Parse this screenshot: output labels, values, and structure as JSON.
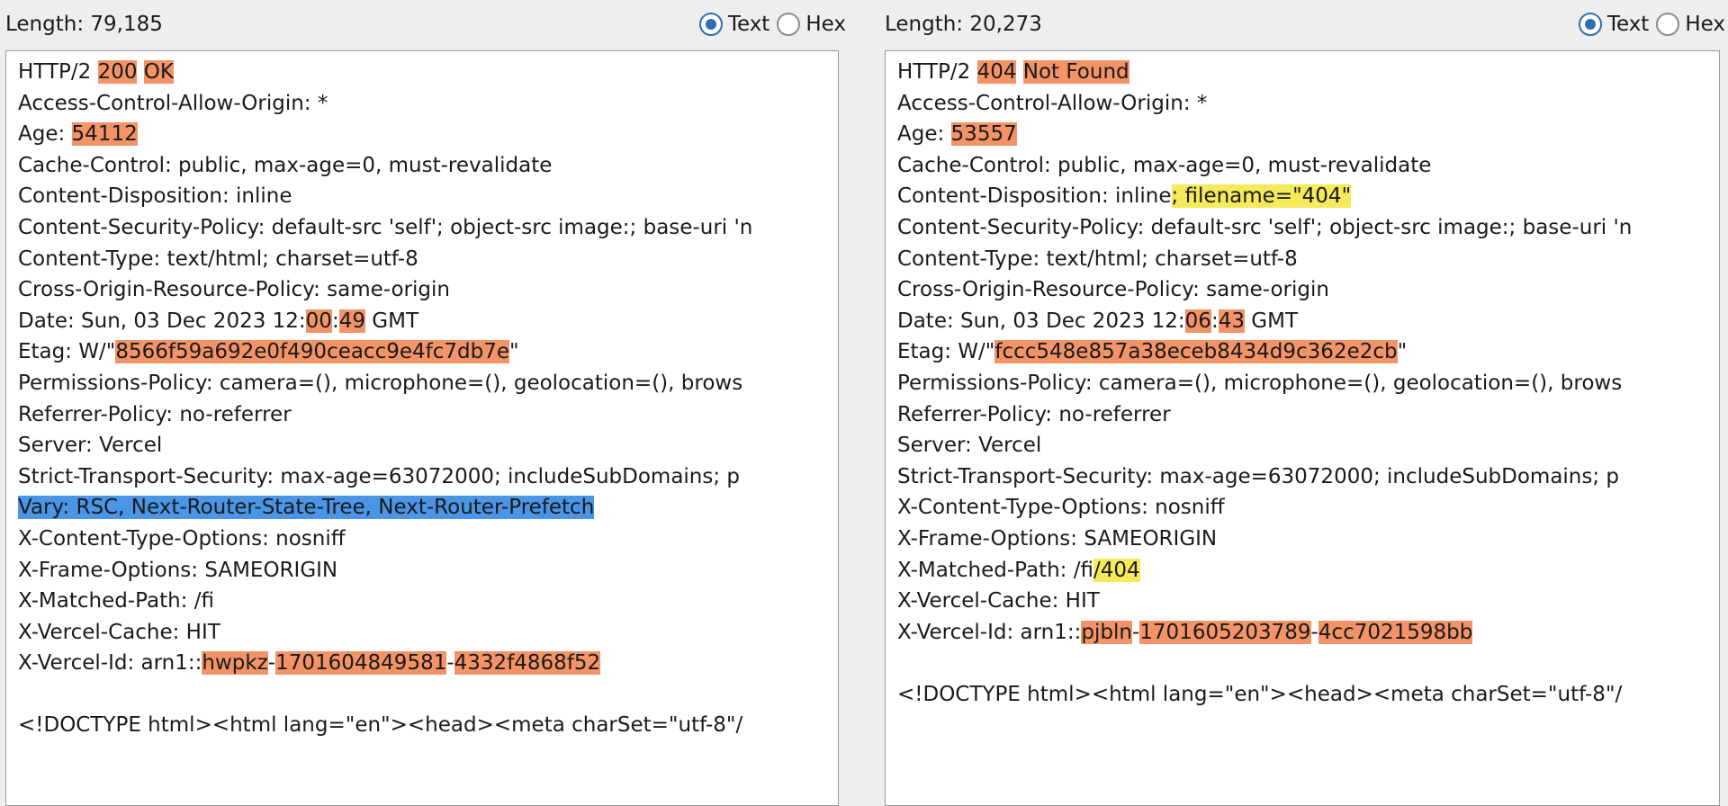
{
  "left": {
    "length_label": "Length: 79,185",
    "view_options": [
      {
        "label": "Text",
        "checked": true
      },
      {
        "label": "Hex",
        "checked": false
      }
    ],
    "lines": [
      [
        {
          "t": "HTTP/2 "
        },
        {
          "t": "200",
          "h": "o"
        },
        {
          "t": " "
        },
        {
          "t": "OK",
          "h": "o"
        }
      ],
      [
        {
          "t": "Access-Control-Allow-Origin: *"
        }
      ],
      [
        {
          "t": "Age: "
        },
        {
          "t": "54112",
          "h": "o"
        }
      ],
      [
        {
          "t": "Cache-Control: public, max-age=0, must-revalidate"
        }
      ],
      [
        {
          "t": "Content-Disposition: inline"
        }
      ],
      [
        {
          "t": "Content-Security-Policy: default-src 'self'; object-src image:; base-uri 'n"
        }
      ],
      [
        {
          "t": "Content-Type: text/html; charset=utf-8"
        }
      ],
      [
        {
          "t": "Cross-Origin-Resource-Policy: same-origin"
        }
      ],
      [
        {
          "t": "Date: Sun, 03 Dec 2023 12:"
        },
        {
          "t": "00",
          "h": "o"
        },
        {
          "t": ":"
        },
        {
          "t": "49",
          "h": "o"
        },
        {
          "t": " GMT"
        }
      ],
      [
        {
          "t": "Etag: W/\""
        },
        {
          "t": "8566f59a692e0f490ceacc9e4fc7db7e",
          "h": "o"
        },
        {
          "t": "\""
        }
      ],
      [
        {
          "t": "Permissions-Policy: camera=(), microphone=(), geolocation=(), brows"
        }
      ],
      [
        {
          "t": "Referrer-Policy: no-referrer"
        }
      ],
      [
        {
          "t": "Server: Vercel"
        }
      ],
      [
        {
          "t": "Strict-Transport-Security: max-age=63072000; includeSubDomains; p"
        }
      ],
      [
        {
          "t": "Vary: RSC, Next-Router-State-Tree, Next-Router-Prefetch",
          "h": "sel"
        }
      ],
      [
        {
          "t": "X-Content-Type-Options: nosniff"
        }
      ],
      [
        {
          "t": "X-Frame-Options: SAMEORIGIN"
        }
      ],
      [
        {
          "t": "X-Matched-Path: /fi"
        }
      ],
      [
        {
          "t": "X-Vercel-Cache: HIT"
        }
      ],
      [
        {
          "t": "X-Vercel-Id: arn1::"
        },
        {
          "t": "hwpkz",
          "h": "o"
        },
        {
          "t": "-"
        },
        {
          "t": "1701604849581",
          "h": "o"
        },
        {
          "t": "-"
        },
        {
          "t": "4332f4868f52",
          "h": "o"
        }
      ],
      [],
      [
        {
          "t": "<!DOCTYPE html><html lang=\"en\"><head><meta charSet=\"utf-8\"/"
        }
      ]
    ]
  },
  "right": {
    "length_label": "Length: 20,273",
    "view_options": [
      {
        "label": "Text",
        "checked": true
      },
      {
        "label": "Hex",
        "checked": false
      }
    ],
    "lines": [
      [
        {
          "t": "HTTP/2 "
        },
        {
          "t": "404",
          "h": "o"
        },
        {
          "t": " "
        },
        {
          "t": "Not Found",
          "h": "o"
        }
      ],
      [
        {
          "t": "Access-Control-Allow-Origin: *"
        }
      ],
      [
        {
          "t": "Age: "
        },
        {
          "t": "53557",
          "h": "o"
        }
      ],
      [
        {
          "t": "Cache-Control: public, max-age=0, must-revalidate"
        }
      ],
      [
        {
          "t": "Content-Disposition: inline"
        },
        {
          "t": "; filename=\"404\"",
          "h": "y"
        }
      ],
      [
        {
          "t": "Content-Security-Policy: default-src 'self'; object-src image:; base-uri 'n"
        }
      ],
      [
        {
          "t": "Content-Type: text/html; charset=utf-8"
        }
      ],
      [
        {
          "t": "Cross-Origin-Resource-Policy: same-origin"
        }
      ],
      [
        {
          "t": "Date: Sun, 03 Dec 2023 12:"
        },
        {
          "t": "06",
          "h": "o"
        },
        {
          "t": ":"
        },
        {
          "t": "43",
          "h": "o"
        },
        {
          "t": " GMT"
        }
      ],
      [
        {
          "t": "Etag: W/\""
        },
        {
          "t": "fccc548e857a38eceb8434d9c362e2cb",
          "h": "o"
        },
        {
          "t": "\""
        }
      ],
      [
        {
          "t": "Permissions-Policy: camera=(), microphone=(), geolocation=(), brows"
        }
      ],
      [
        {
          "t": "Referrer-Policy: no-referrer"
        }
      ],
      [
        {
          "t": "Server: Vercel"
        }
      ],
      [
        {
          "t": "Strict-Transport-Security: max-age=63072000; includeSubDomains; p"
        }
      ],
      [
        {
          "t": "X-Content-Type-Options: nosniff"
        }
      ],
      [
        {
          "t": "X-Frame-Options: SAMEORIGIN"
        }
      ],
      [
        {
          "t": "X-Matched-Path: /fi"
        },
        {
          "t": "/404",
          "h": "y"
        }
      ],
      [
        {
          "t": "X-Vercel-Cache: HIT"
        }
      ],
      [
        {
          "t": "X-Vercel-Id: arn1::"
        },
        {
          "t": "pjbln",
          "h": "o"
        },
        {
          "t": "-"
        },
        {
          "t": "1701605203789",
          "h": "o"
        },
        {
          "t": "-"
        },
        {
          "t": "4cc7021598bb",
          "h": "o"
        }
      ],
      [],
      [
        {
          "t": "<!DOCTYPE html><html lang=\"en\"><head><meta charSet=\"utf-8\"/"
        }
      ]
    ]
  },
  "colors": {
    "diff_modified": "#f39367",
    "diff_added": "#f5ea59",
    "selection": "#4a95e6",
    "radio_accent": "#2e6fb0"
  }
}
